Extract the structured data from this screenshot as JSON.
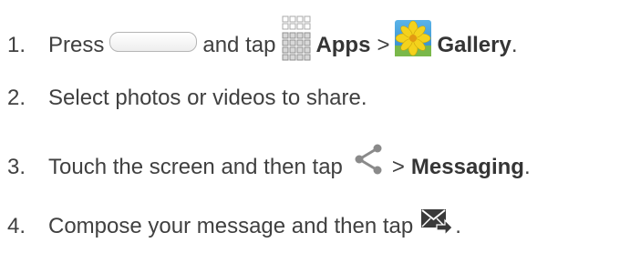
{
  "steps": [
    {
      "num": "1.",
      "t1": "Press",
      "t2": "and tap",
      "bold1": "Apps",
      "t3": ">",
      "bold2": "Gallery",
      "t4": "."
    },
    {
      "num": "2.",
      "t1": "Select photos or videos to share."
    },
    {
      "num": "3.",
      "t1": "Touch the screen and then tap",
      "t2": ">",
      "bold1": "Messaging",
      "t3": "."
    },
    {
      "num": "4.",
      "t1": "Compose your message and then tap",
      "t2": "."
    }
  ],
  "icons": {
    "home": "home-key-icon",
    "apps": "apps-grid-icon",
    "gallery": "gallery-app-icon",
    "share": "share-icon",
    "send": "send-message-icon"
  }
}
